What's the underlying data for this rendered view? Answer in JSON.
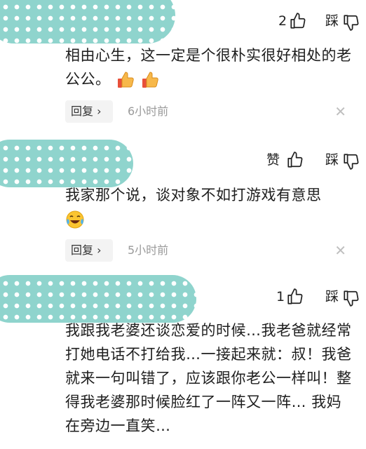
{
  "comments": [
    {
      "like_label": "2",
      "dislike_label": "踩",
      "text": "相由心生，这一定是个很朴实很好相处的老公公。",
      "emojis": [
        "thumbs-up",
        "thumbs-up"
      ],
      "reply_label": "回复 ›",
      "time": "6小时前",
      "close": "✕"
    },
    {
      "like_label": "赞",
      "dislike_label": "踩",
      "text": "我家那个说，谈对象不如打游戏有意思",
      "emojis": [
        "laugh-cry"
      ],
      "reply_label": "回复 ›",
      "time": "5小时前",
      "close": "✕"
    },
    {
      "like_label": "1",
      "dislike_label": "踩",
      "text": "我跟我老婆还谈恋爱的时候…我老爸就经常打她电话不打给我…一接起来就：叔！我爸就来一句叫错了，应该跟你老公一样叫！整得我老婆那时候脸红了一阵又一阵… 我妈在旁边一直笑…"
    }
  ],
  "colors": {
    "mask": "#8fd4cd",
    "text": "#1e1e1e",
    "muted": "#9a9a9a"
  }
}
